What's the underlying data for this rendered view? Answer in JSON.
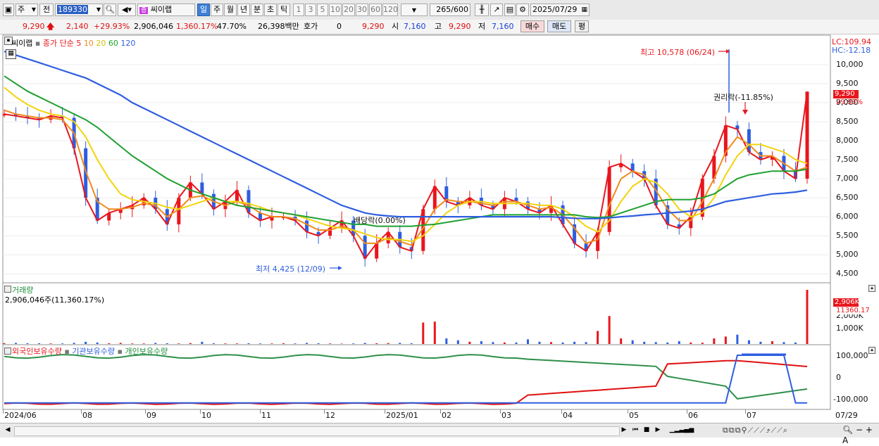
{
  "toolbar": {
    "type_primary": "주",
    "type_secondary": "전",
    "code_value": "189330",
    "stock_name": "씨이랩",
    "periods": [
      "일",
      "주",
      "월",
      "년",
      "분",
      "초",
      "틱"
    ],
    "minutes": [
      "1",
      "3",
      "5",
      "10",
      "20",
      "30",
      "60",
      "120"
    ],
    "count": "265",
    "count_total": "/600",
    "date": "2025/07/29"
  },
  "quote": {
    "price": "9,290",
    "change": "2,140",
    "change_pct": "+29.93%",
    "volume": "2,906,046",
    "volume_pct": "1,360.17%",
    "turnover_pct": "47.70%",
    "amount": "26,398백만",
    "bid_label": "호가",
    "bid_value": "0",
    "ask_price": "9,290",
    "open_label": "시",
    "open": "7,160",
    "high_label": "고",
    "high": "9,290",
    "low_label": "저",
    "low": "7,160",
    "buy_label": "매수",
    "sell_label": "매도",
    "eval_label": "평"
  },
  "price_panel": {
    "title": "씨이랩",
    "ma_label": "종가 단순",
    "ma_periods": [
      "5",
      "10",
      "20",
      "60",
      "120"
    ],
    "ma_colors": [
      "#e8161d",
      "#f08a1d",
      "#f2d40e",
      "#1ea02f",
      "#2e5ee0"
    ],
    "lc": "LC:109.94",
    "hc": "HC:-12.18",
    "y_ticks": [
      "10,000",
      "9,500",
      "9,000",
      "8,500",
      "8,000",
      "7,500",
      "7,000",
      "6,500",
      "6,000",
      "5,500",
      "5,000",
      "4,500"
    ],
    "price_tag": "9,290",
    "pct_tag": "29.93%",
    "high_annot": "최고 10,578 (06/24)",
    "low_annot": "최저 4,425 (12/09)",
    "rights_annot": "권리락(-11.85%)",
    "dividend_annot": "배당락(0.00%)"
  },
  "volume_panel": {
    "title": "거래량",
    "value": "2,906,046주(11,360.17%)",
    "y_ticks": [
      "2,000K",
      "1,000K"
    ],
    "tag_value": "2,906K",
    "tag_pct": "11360.17"
  },
  "holding_panel": {
    "legend": [
      "외국인보유수량",
      "기관보유수량",
      "개인보유수량"
    ],
    "legend_colors": [
      "#e8161d",
      "#2e5ee0",
      "#1e8f3a"
    ],
    "y_ticks": [
      "100,000",
      "0",
      "-100,000"
    ]
  },
  "dates": [
    "2024/06",
    "08",
    "09",
    "10",
    "11",
    "12",
    "2025/01",
    "02",
    "03",
    "04",
    "05",
    "06",
    "07",
    "07/29"
  ],
  "chart_data": {
    "type": "candlestick",
    "title": "씨이랩",
    "x_labels": [
      "2024/06",
      "08",
      "09",
      "10",
      "11",
      "12",
      "2025/01",
      "02",
      "03",
      "04",
      "05",
      "06",
      "07"
    ],
    "ylim": [
      4300,
      10700
    ],
    "high": {
      "value": 10578,
      "date": "06/24"
    },
    "low": {
      "value": 4425,
      "date": "12/09"
    },
    "last_close": 9290,
    "ma_series": [
      {
        "name": "5",
        "values": [
          8700,
          8650,
          8600,
          8550,
          8650,
          8600,
          7800,
          6500,
          5900,
          6100,
          6200,
          6300,
          6500,
          6200,
          5800,
          6500,
          6900,
          6600,
          6200,
          6400,
          6700,
          6100,
          5900,
          6000,
          6000,
          5900,
          5600,
          5500,
          5700,
          5900,
          5500,
          4900,
          5300,
          5600,
          5200,
          5100,
          6200,
          6800,
          6400,
          6300,
          6500,
          6300,
          6200,
          6500,
          6400,
          6200,
          6100,
          6300,
          5800,
          5300,
          5100,
          5600,
          7300,
          7400,
          7200,
          7000,
          6300,
          5800,
          5700,
          6000,
          7000,
          7600,
          8400,
          8300,
          7700,
          7500,
          7600,
          7200,
          7000,
          9290
        ]
      },
      {
        "name": "10",
        "values": [
          8800,
          8700,
          8650,
          8600,
          8600,
          8550,
          8200,
          7200,
          6400,
          6200,
          6200,
          6250,
          6350,
          6300,
          6000,
          6200,
          6500,
          6550,
          6400,
          6300,
          6400,
          6300,
          6100,
          6000,
          6000,
          5950,
          5800,
          5650,
          5650,
          5750,
          5650,
          5300,
          5300,
          5450,
          5350,
          5250,
          5700,
          6200,
          6450,
          6400,
          6400,
          6350,
          6300,
          6400,
          6400,
          6300,
          6200,
          6250,
          6050,
          5700,
          5300,
          5400,
          6300,
          7000,
          7200,
          7100,
          6700,
          6200,
          5900,
          5900,
          6400,
          7000,
          7700,
          8100,
          7900,
          7600,
          7600,
          7400,
          7200,
          7300
        ]
      },
      {
        "name": "20",
        "values": [
          9400,
          9150,
          8950,
          8800,
          8700,
          8650,
          8500,
          8100,
          7500,
          7000,
          6600,
          6450,
          6400,
          6350,
          6250,
          6200,
          6300,
          6400,
          6500,
          6400,
          6400,
          6350,
          6250,
          6150,
          6100,
          6050,
          5950,
          5850,
          5750,
          5700,
          5650,
          5550,
          5450,
          5400,
          5400,
          5350,
          5500,
          5800,
          6100,
          6300,
          6400,
          6400,
          6350,
          6350,
          6350,
          6350,
          6300,
          6300,
          6200,
          6000,
          5750,
          5600,
          5900,
          6400,
          6800,
          7000,
          6900,
          6600,
          6200,
          6000,
          6100,
          6500,
          7100,
          7600,
          7900,
          7900,
          7800,
          7700,
          7500,
          7400
        ]
      },
      {
        "name": "60",
        "values": [
          9700,
          9500,
          9300,
          9150,
          9000,
          8850,
          8700,
          8550,
          8350,
          8100,
          7850,
          7600,
          7400,
          7200,
          7000,
          6850,
          6700,
          6600,
          6500,
          6400,
          6300,
          6250,
          6200,
          6150,
          6100,
          6050,
          6000,
          5950,
          5900,
          5850,
          5800,
          5800,
          5750,
          5750,
          5750,
          5750,
          5780,
          5800,
          5850,
          5900,
          5950,
          6000,
          6050,
          6050,
          6050,
          6050,
          6050,
          6050,
          6050,
          6050,
          6000,
          5980,
          6000,
          6100,
          6200,
          6300,
          6400,
          6450,
          6450,
          6450,
          6500,
          6600,
          6800,
          7000,
          7100,
          7150,
          7200,
          7200,
          7200,
          7250
        ]
      },
      {
        "name": "120",
        "values": [
          10350,
          10250,
          10150,
          10050,
          9950,
          9850,
          9750,
          9650,
          9500,
          9350,
          9200,
          9000,
          8850,
          8700,
          8550,
          8400,
          8250,
          8100,
          7950,
          7800,
          7650,
          7500,
          7350,
          7200,
          7050,
          6900,
          6750,
          6600,
          6450,
          6300,
          6200,
          6100,
          6050,
          6020,
          6000,
          6000,
          6000,
          6000,
          6000,
          6000,
          6000,
          6000,
          6000,
          6000,
          6000,
          6000,
          6000,
          6000,
          5980,
          5960,
          5950,
          5950,
          5970,
          6000,
          6020,
          6050,
          6070,
          6100,
          6120,
          6150,
          6200,
          6300,
          6400,
          6450,
          6500,
          6550,
          6600,
          6620,
          6650,
          6700
        ]
      }
    ],
    "volume_bars_k": [
      45,
      60,
      40,
      40,
      30,
      30,
      60,
      120,
      80,
      40,
      60,
      30,
      30,
      60,
      40,
      30,
      50,
      120,
      40,
      30,
      30,
      40,
      30,
      30,
      40,
      30,
      60,
      40,
      30,
      20,
      30,
      60,
      40,
      50,
      60,
      40,
      1150,
      1200,
      300,
      200,
      120,
      150,
      100,
      80,
      80,
      250,
      120,
      100,
      80,
      120,
      100,
      700,
      1500,
      300,
      200,
      120,
      100,
      80,
      150,
      80,
      70,
      300,
      400,
      500,
      200,
      120,
      150,
      100,
      80,
      2906
    ]
  }
}
